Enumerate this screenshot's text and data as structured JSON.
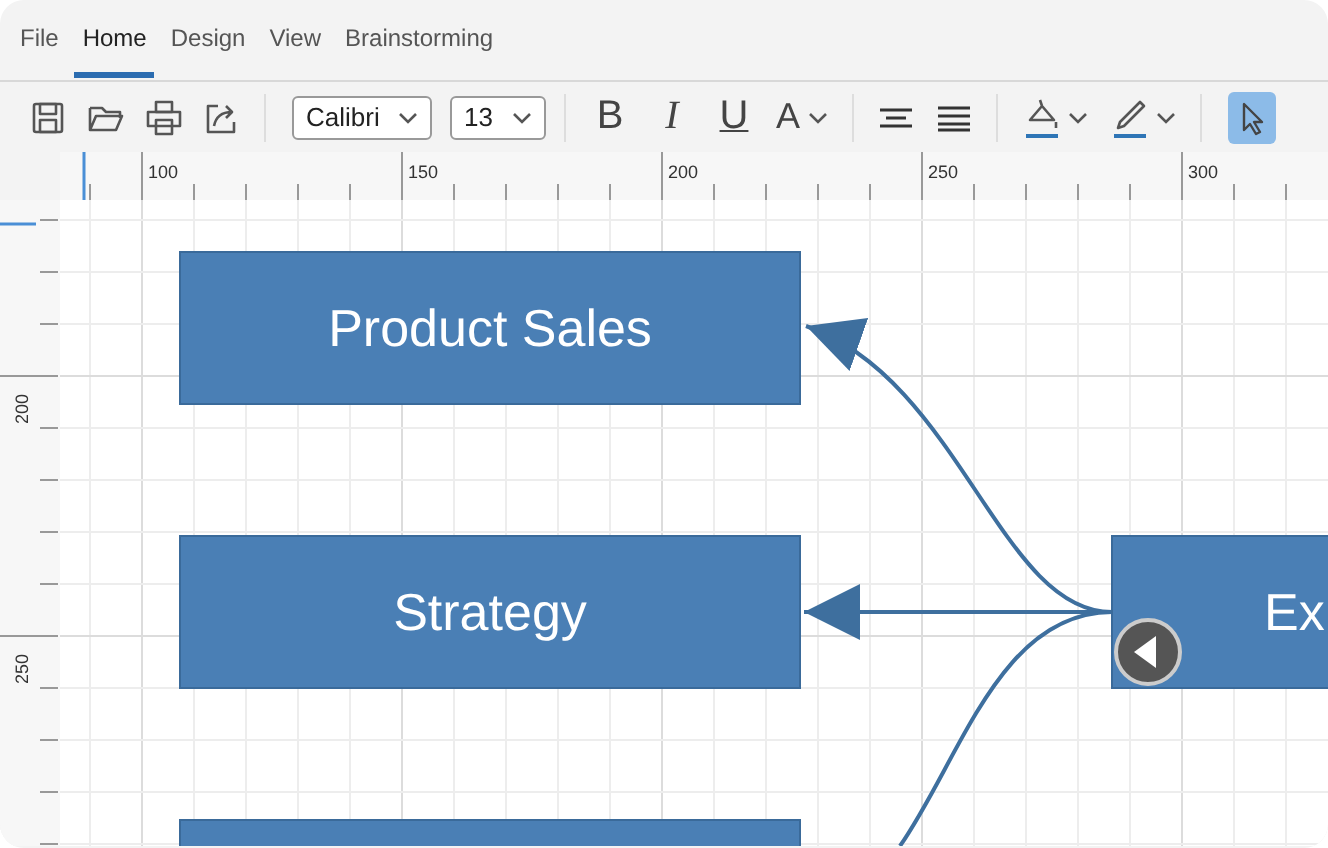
{
  "menu_tabs": [
    {
      "label": "File",
      "selected": false
    },
    {
      "label": "Home",
      "selected": true
    },
    {
      "label": "Design",
      "selected": false
    },
    {
      "label": "View",
      "selected": false
    },
    {
      "label": "Brainstorming",
      "selected": false
    }
  ],
  "toolbar": {
    "font_family": "Calibri",
    "font_size": "13",
    "bold": "B",
    "italic": "I",
    "underline": "U",
    "font_color": "A",
    "pointer_tool": {
      "selected": true
    }
  },
  "rulers": {
    "horizontal": [
      "100",
      "150",
      "200",
      "250",
      "300"
    ],
    "vertical": [
      "200",
      "250"
    ]
  },
  "diagram": {
    "nodes": [
      {
        "kind": "box",
        "label": "Product Sales"
      },
      {
        "kind": "box",
        "label": "Strategy"
      },
      {
        "kind": "box"
      },
      {
        "kind": "box",
        "label": "Ex"
      }
    ],
    "collapse_button": {
      "expanded": true
    }
  }
}
